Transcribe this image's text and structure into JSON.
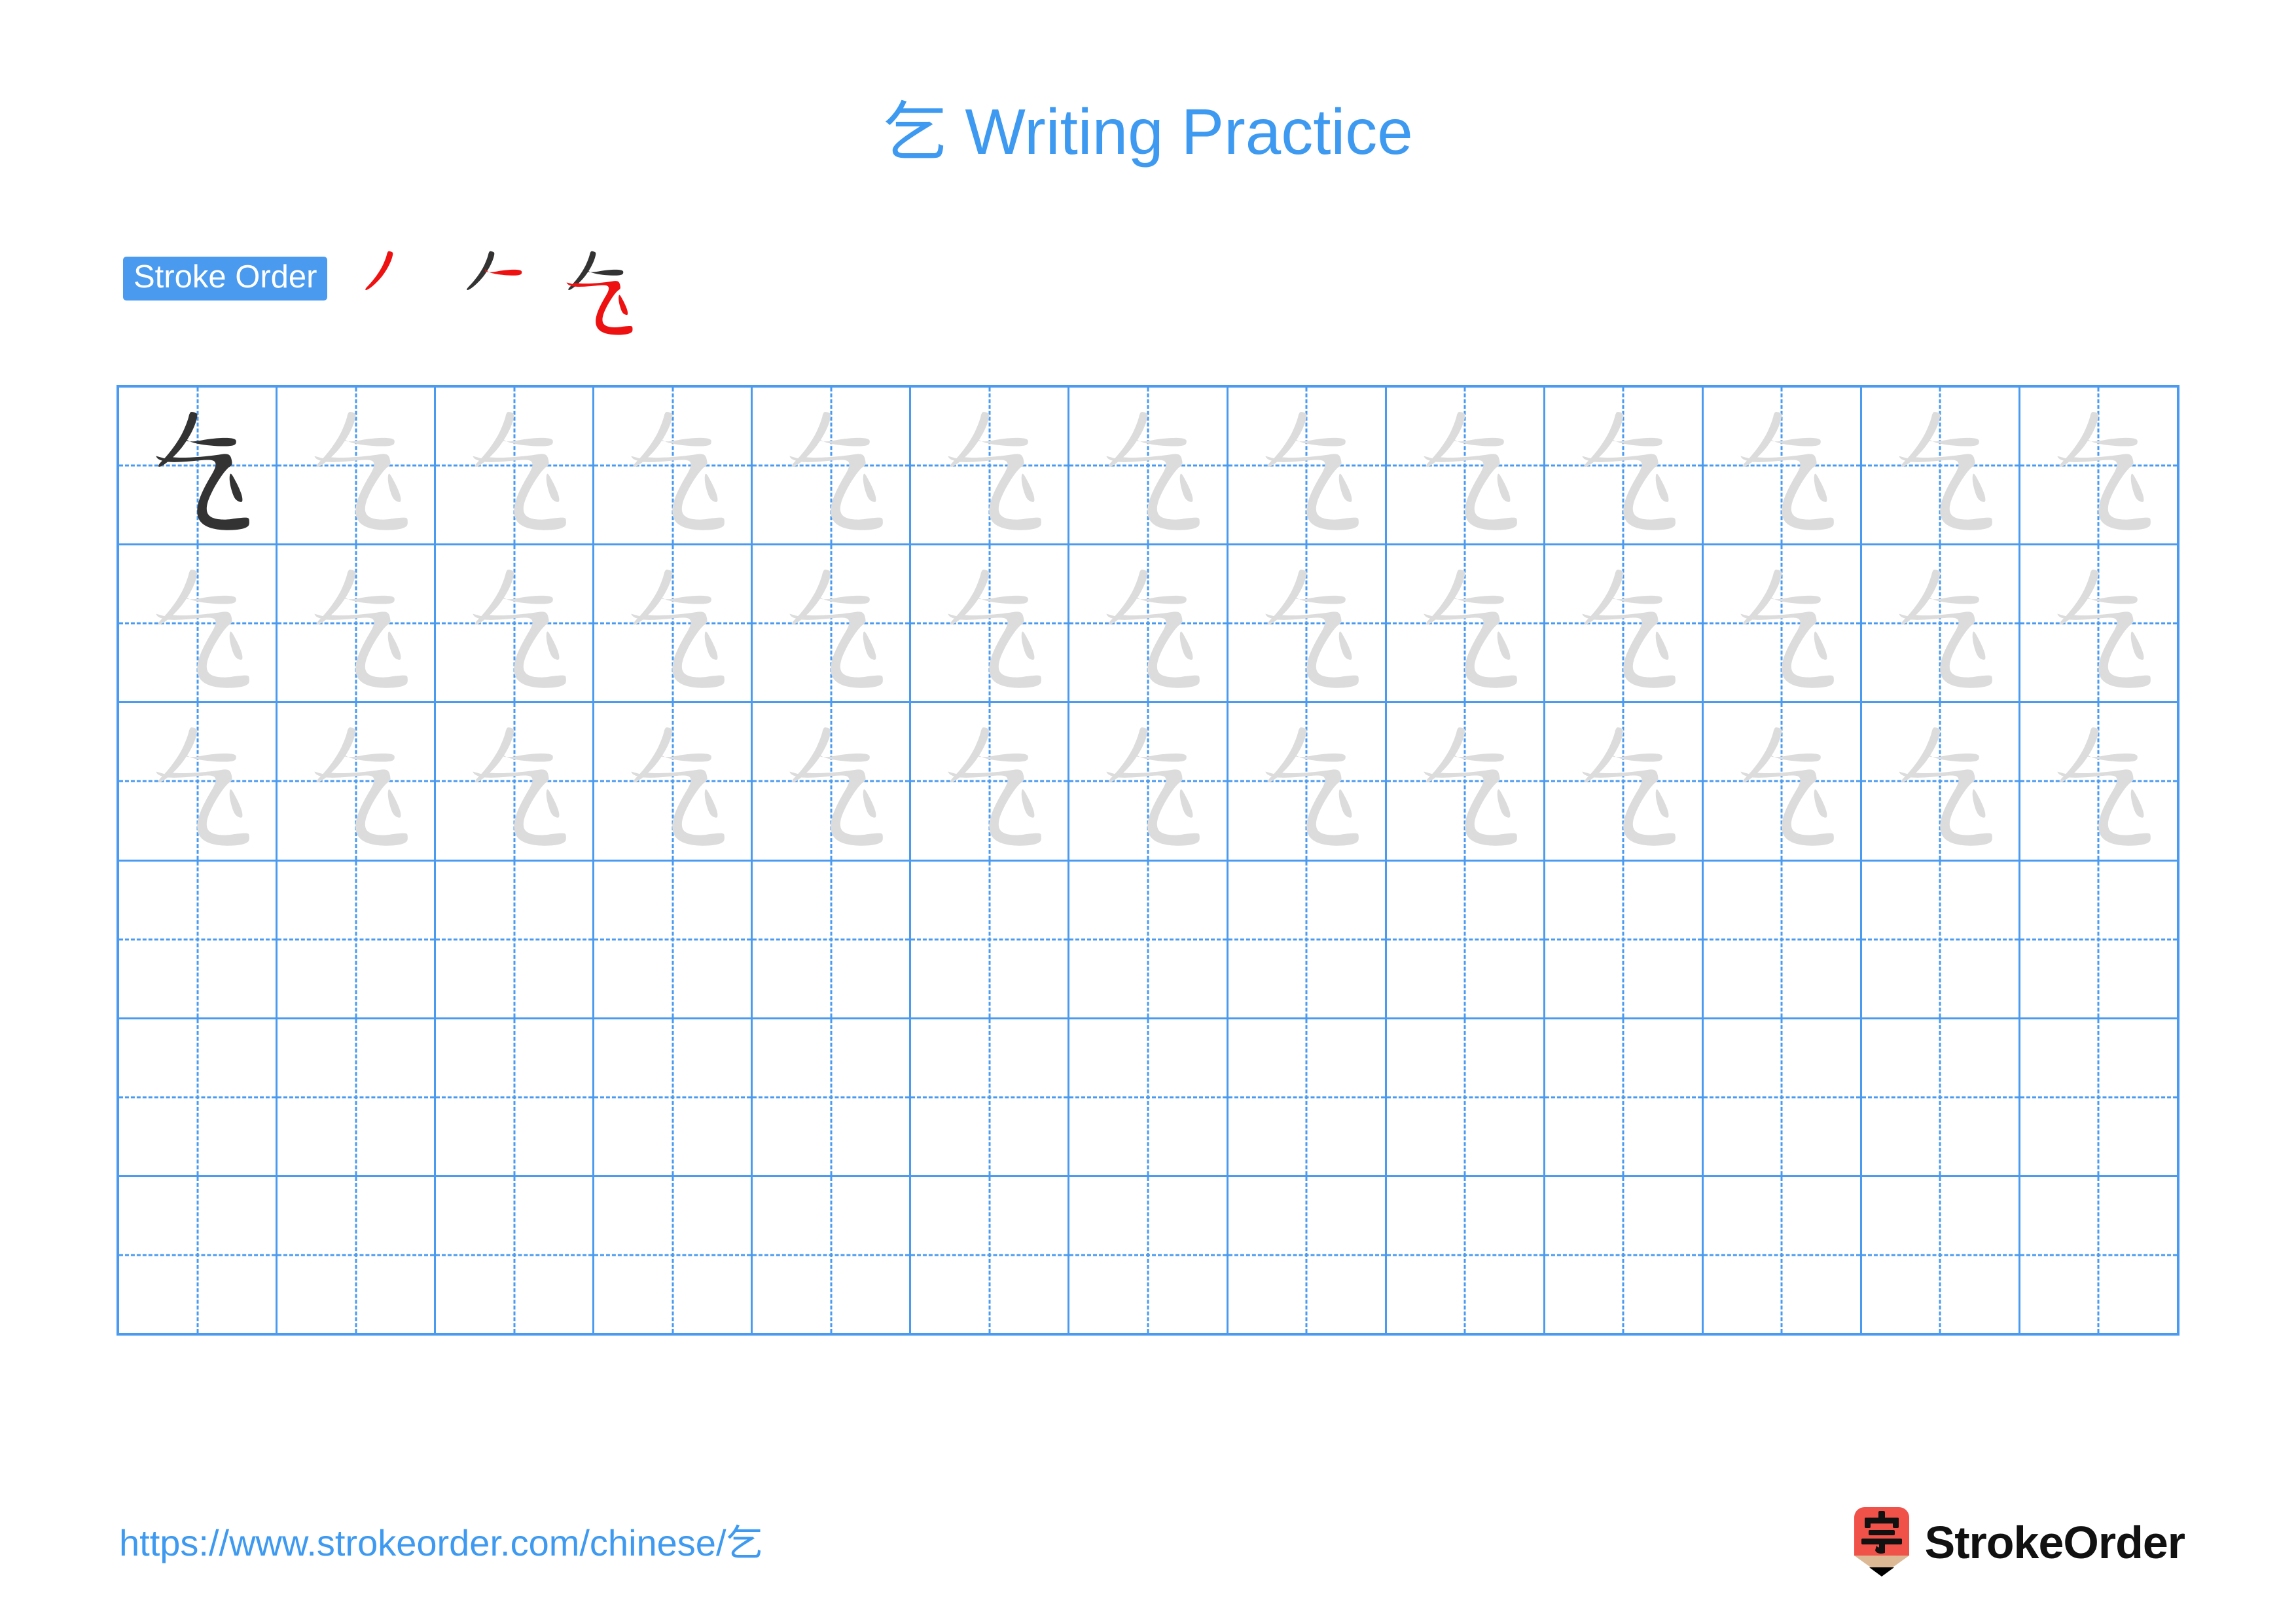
{
  "page": {
    "character": "乞",
    "title_prefix": "乞",
    "title_suffix": " Writing Practice",
    "title_full": "乞 Writing Practice",
    "background_color": "#ffffff",
    "accent_blue": "#4a9bf0",
    "title_blue": "#3d9af0",
    "stroke_new_color": "#ee1111",
    "stroke_done_color": "#333333",
    "trace_gray": "#dcdcdc",
    "ink_dark": "#333333"
  },
  "stroke_order": {
    "badge_label": "Stroke Order",
    "stroke_count": 3,
    "steps": [
      {
        "index": 1,
        "label": "stroke-step-1",
        "new_stroke": 1,
        "strokes_shown": 1
      },
      {
        "index": 2,
        "label": "stroke-step-2",
        "new_stroke": 2,
        "strokes_shown": 2
      },
      {
        "index": 3,
        "label": "stroke-step-3",
        "new_stroke": 3,
        "strokes_shown": 3
      }
    ]
  },
  "practice_grid": {
    "columns": 13,
    "rows": 6,
    "cells": [
      [
        "dark",
        "trace",
        "trace",
        "trace",
        "trace",
        "trace",
        "trace",
        "trace",
        "trace",
        "trace",
        "trace",
        "trace",
        "trace"
      ],
      [
        "trace",
        "trace",
        "trace",
        "trace",
        "trace",
        "trace",
        "trace",
        "trace",
        "trace",
        "trace",
        "trace",
        "trace",
        "trace"
      ],
      [
        "trace",
        "trace",
        "trace",
        "trace",
        "trace",
        "trace",
        "trace",
        "trace",
        "trace",
        "trace",
        "trace",
        "trace",
        "trace"
      ],
      [
        "empty",
        "empty",
        "empty",
        "empty",
        "empty",
        "empty",
        "empty",
        "empty",
        "empty",
        "empty",
        "empty",
        "empty",
        "empty"
      ],
      [
        "empty",
        "empty",
        "empty",
        "empty",
        "empty",
        "empty",
        "empty",
        "empty",
        "empty",
        "empty",
        "empty",
        "empty",
        "empty"
      ],
      [
        "empty",
        "empty",
        "empty",
        "empty",
        "empty",
        "empty",
        "empty",
        "empty",
        "empty",
        "empty",
        "empty",
        "empty",
        "empty"
      ]
    ]
  },
  "footer": {
    "url_text": "https://www.strokeorder.com/chinese/乞",
    "url_prefix": "https://www.strokeorder.com/chinese/",
    "url_character": "乞",
    "brand_name": "StrokeOrder",
    "logo_character": "字",
    "logo_body_color": "#f0524a",
    "logo_wood_color": "#dcb894",
    "logo_tip_color": "#000000"
  }
}
